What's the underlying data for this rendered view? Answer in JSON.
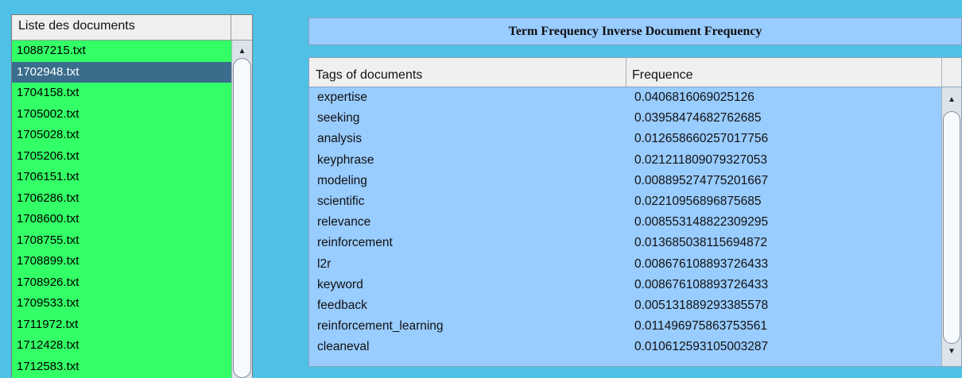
{
  "document_list": {
    "header": "Liste des documents",
    "selected_index": 1,
    "items": [
      "10887215.txt",
      "1702948.txt",
      "1704158.txt",
      "1705002.txt",
      "1705028.txt",
      "1705206.txt",
      "1706151.txt",
      "1706286.txt",
      "1708600.txt",
      "1708755.txt",
      "1708899.txt",
      "1708926.txt",
      "1709533.txt",
      "1711972.txt",
      "1712428.txt",
      "1712583.txt"
    ]
  },
  "tfidf": {
    "title": "Term Frequency Inverse Document Frequency",
    "columns": {
      "tags": "Tags of documents",
      "frequence": "Frequence"
    },
    "rows": [
      {
        "tag": "expertise",
        "freq": "0.0406816069025126"
      },
      {
        "tag": "seeking",
        "freq": "0.03958474682762685"
      },
      {
        "tag": "analysis",
        "freq": "0.012658660257017756"
      },
      {
        "tag": "keyphrase",
        "freq": "0.021211809079327053"
      },
      {
        "tag": "modeling",
        "freq": "0.008895274775201667"
      },
      {
        "tag": "scientific",
        "freq": "0.02210956896875685"
      },
      {
        "tag": "relevance",
        "freq": "0.008553148822309295"
      },
      {
        "tag": "reinforcement",
        "freq": "0.013685038115694872"
      },
      {
        "tag": "l2r",
        "freq": "0.008676108893726433"
      },
      {
        "tag": "keyword",
        "freq": "0.008676108893726433"
      },
      {
        "tag": "feedback",
        "freq": "0.005131889293385578"
      },
      {
        "tag": "reinforcement_learning",
        "freq": "0.011496975863753561"
      },
      {
        "tag": "cleaneval",
        "freq": "0.010612593105003287"
      }
    ]
  },
  "icons": {
    "scroll_up": "arrow-up-icon",
    "scroll_down": "arrow-down-icon"
  },
  "colors": {
    "background": "#4fc1e6",
    "list_bg": "#33ff66",
    "selection": "#3a6d8c",
    "table_bg": "#99ccff"
  }
}
